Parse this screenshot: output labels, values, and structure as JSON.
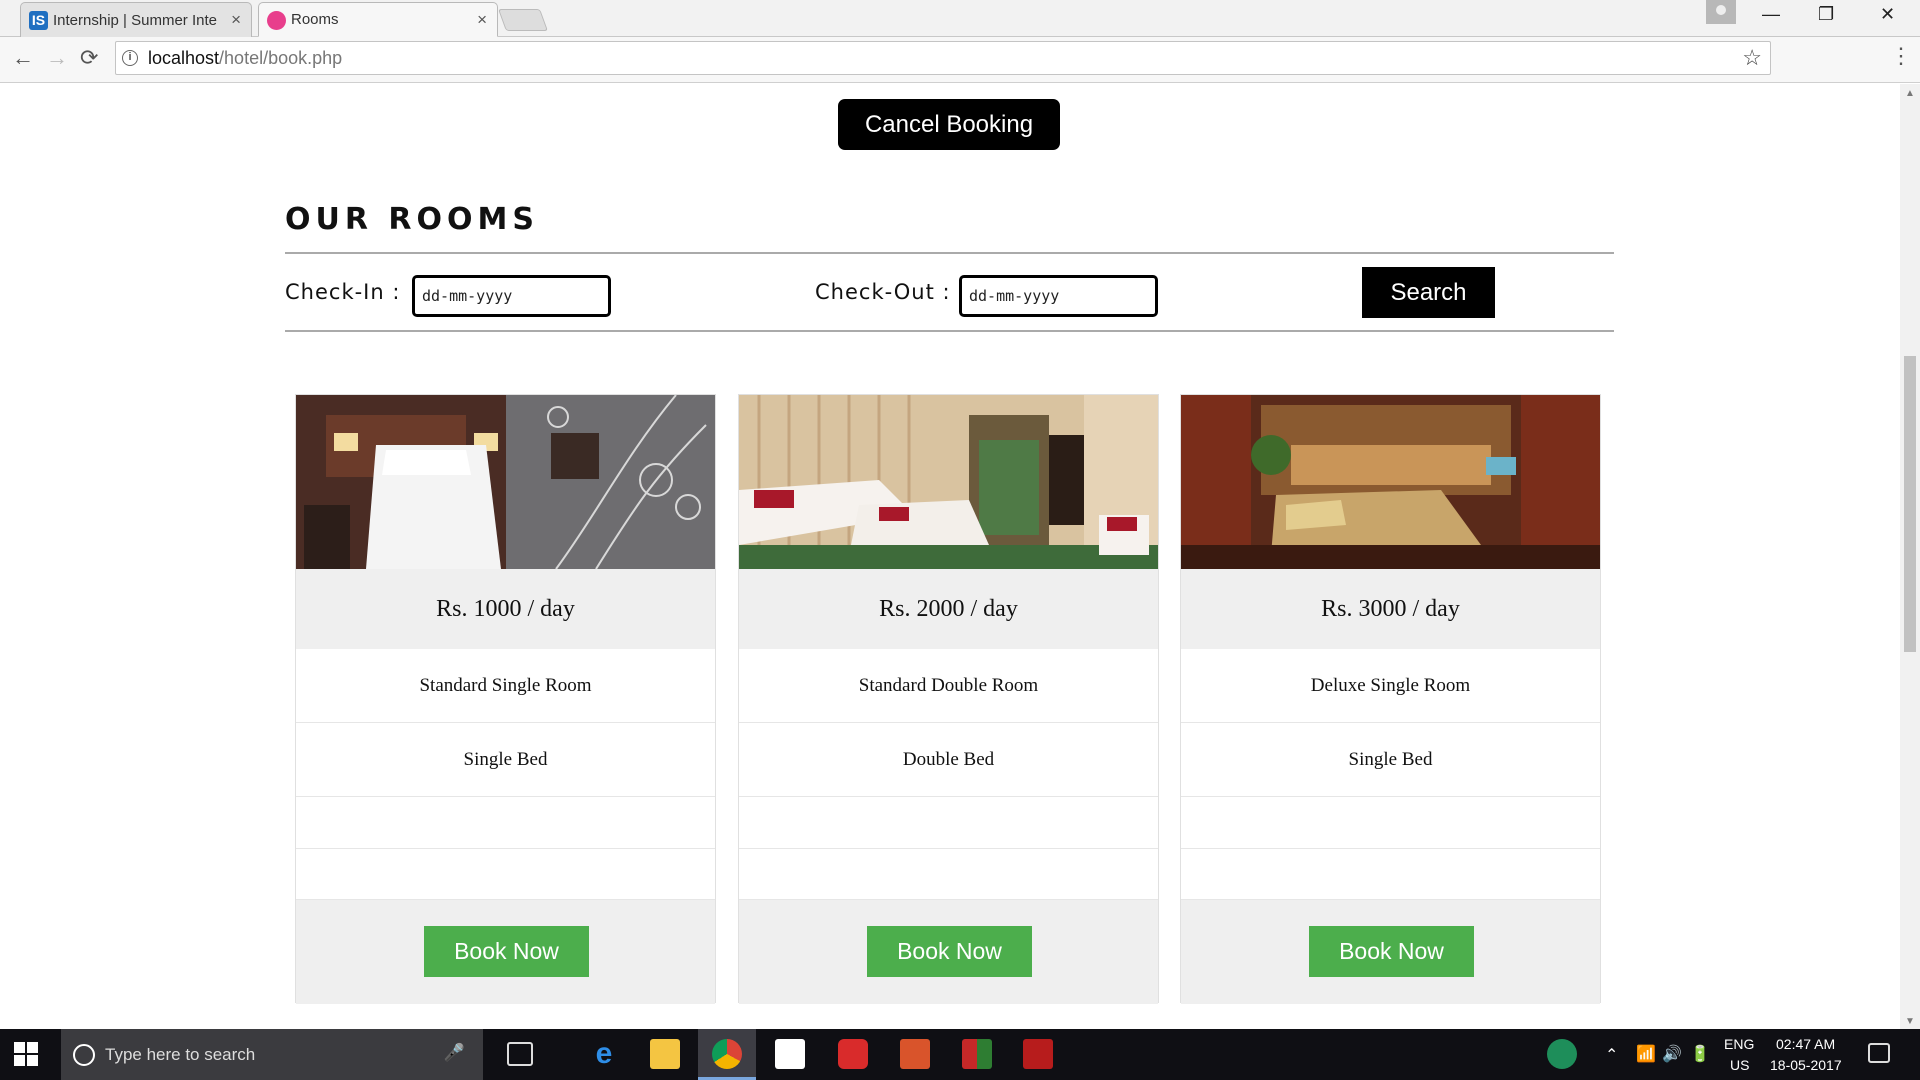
{
  "browser": {
    "tabs": [
      {
        "title": "Internship | Summer Inte",
        "icon": "internshala-icon",
        "active": false
      },
      {
        "title": "Rooms",
        "icon": "page-icon",
        "active": true
      }
    ],
    "close_glyph": "×",
    "url_host": "localhost",
    "url_path": "/hotel/book.php",
    "window": {
      "minimize": "—",
      "restore": "❐",
      "close": "✕"
    },
    "nav": {
      "back": "←",
      "forward": "→",
      "reload": "⟳",
      "info": "i",
      "star": "☆",
      "menu": "⋮"
    }
  },
  "page": {
    "cancel_label": "Cancel Booking",
    "heading": "OUR ROOMS",
    "checkin_label": "Check-In :",
    "checkout_label": "Check-Out :",
    "date_placeholder": "dd-mm-yyyy",
    "search_label": "Search",
    "rooms": [
      {
        "price": "Rs. 1000 / day",
        "name": "Standard Single Room",
        "bed": "Single Bed",
        "book_label": "Book Now"
      },
      {
        "price": "Rs. 2000 / day",
        "name": "Standard Double Room",
        "bed": "Double Bed",
        "book_label": "Book Now"
      },
      {
        "price": "Rs. 3000 / day",
        "name": "Deluxe Single Room",
        "bed": "Single Bed",
        "book_label": "Book Now"
      }
    ]
  },
  "taskbar": {
    "search_placeholder": "Type here to search",
    "lang_top": "ENG",
    "lang_bottom": "US",
    "time": "02:47 AM",
    "date": "18-05-2017"
  },
  "colors": {
    "book_button": "#4cae4c",
    "dark_button": "#000000",
    "panel_grey": "#efefef"
  }
}
